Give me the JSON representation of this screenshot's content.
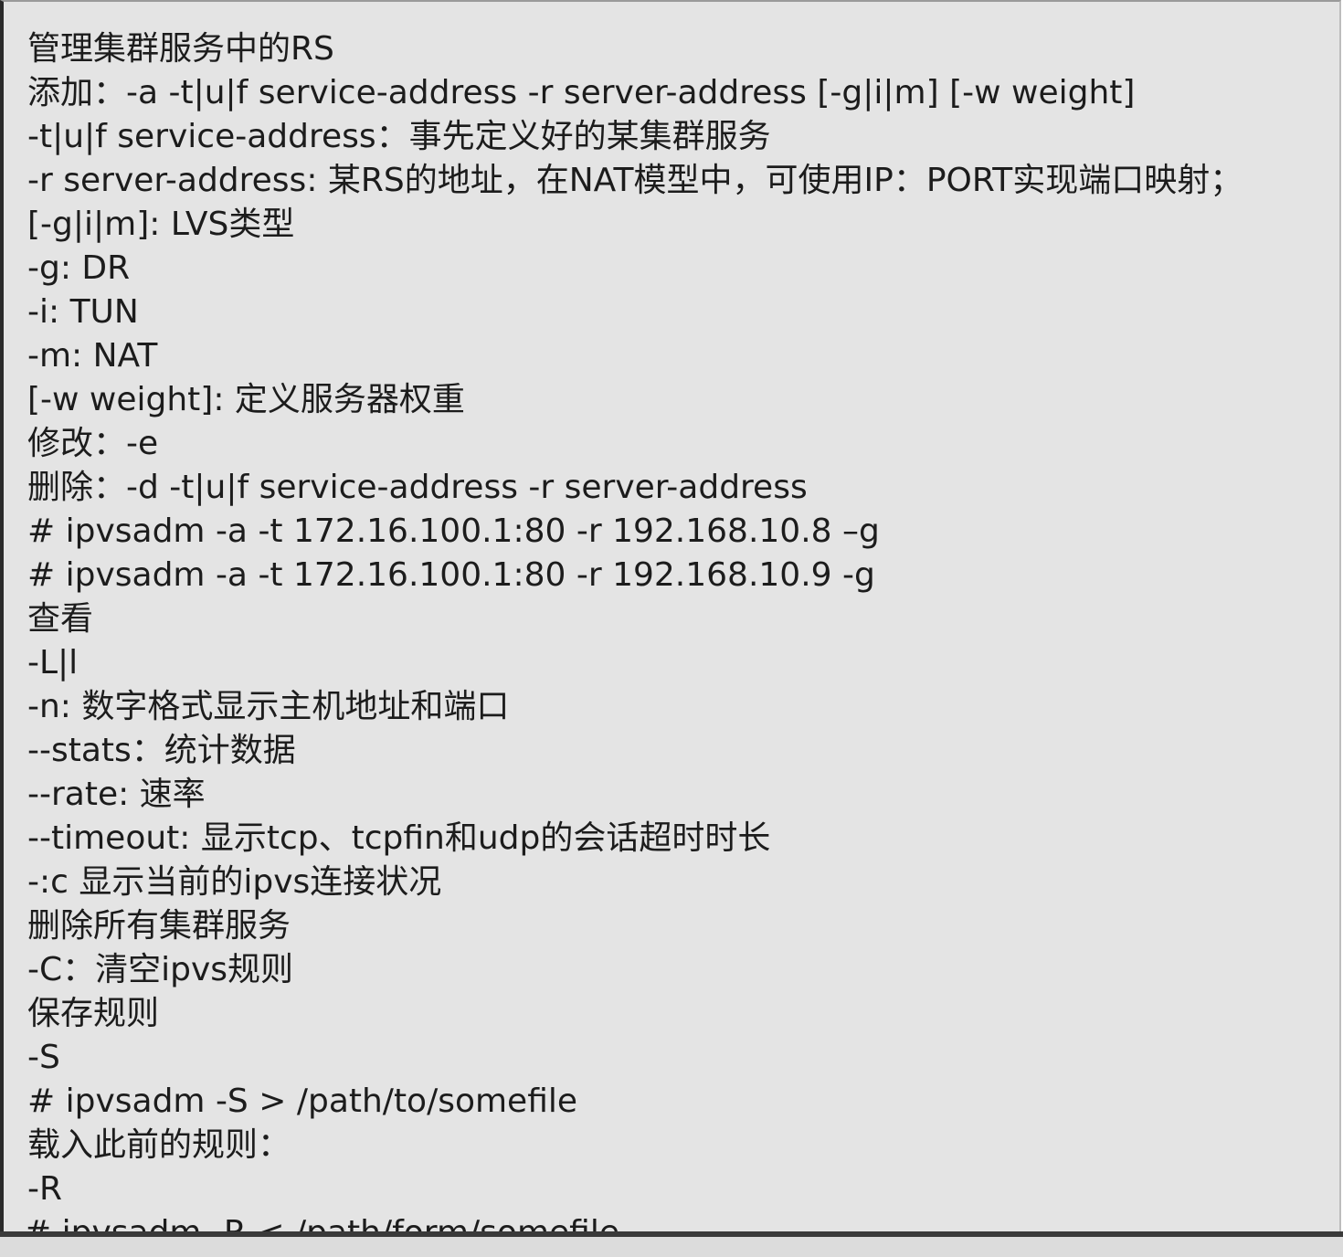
{
  "lines": [
    "管理集群服务中的RS",
    "添加：-a -t|u|f service-address -r server-address [-g|i|m] [-w weight]",
    "-t|u|f service-address：事先定义好的某集群服务",
    "-r server-address: 某RS的地址，在NAT模型中，可使用IP：PORT实现端口映射；",
    "[-g|i|m]: LVS类型",
    "-g: DR",
    "-i: TUN",
    "-m: NAT",
    "[-w weight]: 定义服务器权重",
    "修改：-e",
    "删除：-d -t|u|f service-address -r server-address",
    "# ipvsadm -a -t 172.16.100.1:80 -r 192.168.10.8 –g",
    "# ipvsadm -a -t 172.16.100.1:80 -r 192.168.10.9 -g",
    "查看",
    "-L|l",
    "-n: 数字格式显示主机地址和端口",
    "--stats：统计数据",
    "--rate: 速率",
    "--timeout: 显示tcp、tcpfin和udp的会话超时时长",
    "-:c 显示当前的ipvs连接状况",
    "删除所有集群服务",
    "-C：清空ipvs规则",
    "保存规则",
    "-S",
    "# ipvsadm -S > /path/to/somefile",
    "载入此前的规则：",
    "-R"
  ],
  "last_line_partial": "# ipvsadm -R < /path/form/somefile"
}
